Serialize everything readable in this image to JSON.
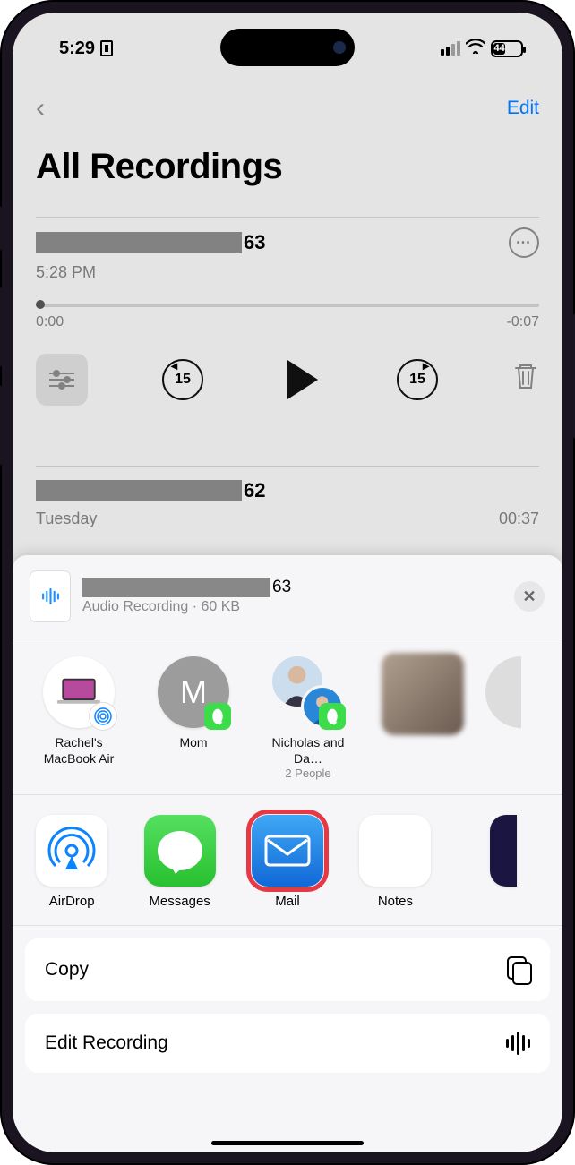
{
  "status": {
    "time": "5:29",
    "battery_pct": "44"
  },
  "nav": {
    "edit": "Edit"
  },
  "title": "All Recordings",
  "recording1": {
    "suffix": "63",
    "timestamp": "5:28 PM",
    "elapsed": "0:00",
    "remaining": "-0:07",
    "skip_amount": "15"
  },
  "recording2": {
    "suffix": "62",
    "day": "Tuesday",
    "duration": "00:37"
  },
  "share": {
    "file_suffix": "63",
    "file_meta": "Audio Recording · 60 KB",
    "contacts": [
      {
        "label": "Rachel's MacBook Air",
        "sub": ""
      },
      {
        "label": "Mom",
        "sub": ""
      },
      {
        "label": "Nicholas and Da…",
        "sub": "2 People"
      }
    ],
    "apps": {
      "airdrop": "AirDrop",
      "messages": "Messages",
      "mail": "Mail",
      "notes": "Notes"
    },
    "actions": {
      "copy": "Copy",
      "edit_recording": "Edit Recording"
    }
  }
}
